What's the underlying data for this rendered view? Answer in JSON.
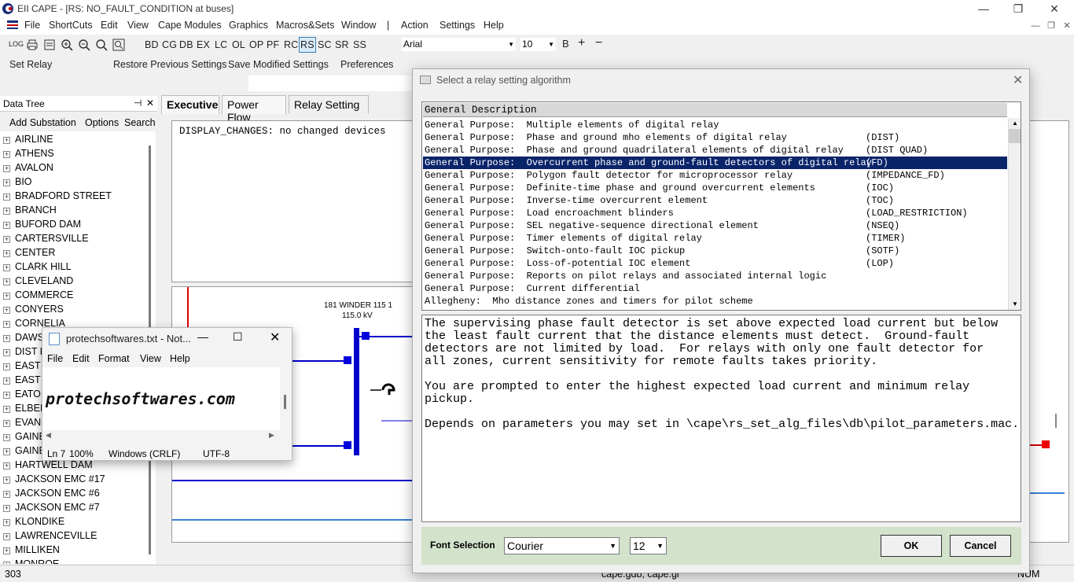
{
  "window": {
    "title": "EII CAPE - [RS: NO_FAULT_CONDITION at buses]",
    "controls": [
      "—",
      "❐",
      "✕"
    ]
  },
  "menubar": {
    "items": [
      "File",
      "ShortCuts",
      "Edit",
      "View",
      "Cape Modules",
      "Graphics",
      "Macros&Sets",
      "Window",
      "|",
      "Action",
      "Settings",
      "Help"
    ]
  },
  "toolbar": {
    "modules": [
      "BD",
      "CG",
      "DB",
      "EX",
      "LC",
      "OL",
      "OP",
      "PF",
      "RC",
      "RS",
      "SC",
      "SR",
      "SS"
    ],
    "selected_module": "RS",
    "font_name": "Arial",
    "font_size": "10",
    "bold_label": "B"
  },
  "toolbar2": {
    "items": [
      "Set Relay",
      "Restore Previous Settings",
      "Save Modified Settings",
      "Preferences"
    ]
  },
  "data_tree": {
    "title": "Data Tree",
    "pin": "⊣",
    "close": "✕",
    "tools": [
      "Add Substation",
      "Options",
      "Search"
    ],
    "items": [
      "AIRLINE",
      "ATHENS",
      "AVALON",
      "BIO",
      "BRADFORD STREET",
      "BRANCH",
      "BUFORD DAM",
      "CARTERSVILLE",
      "CENTER",
      "CLARK HILL",
      "CLEVELAND",
      "COMMERCE",
      "CONYERS",
      "CORNELIA",
      "DAWS",
      "DIST F",
      "EAST",
      "EAST",
      "EATO",
      "ELBER",
      "EVANS",
      "GAINE",
      "GAINE",
      "HARTWELL DAM",
      "JACKSON EMC #17",
      "JACKSON EMC #6",
      "JACKSON EMC #7",
      "KLONDIKE",
      "LAWRENCEVILLE",
      "MILLIKEN",
      "MONROE"
    ]
  },
  "tabs": [
    "Executive",
    "Power Flow",
    "Relay Setting"
  ],
  "active_tab": "Relay Setting",
  "display": {
    "text": "DISPLAY_CHANGES: no changed devices"
  },
  "diagram": {
    "bus_name": "181 WINDER 115 1",
    "bus_kv": "115.0 kV"
  },
  "status_bar": {
    "left": "303",
    "middle": "cape.gdb, cape.gr",
    "right": "NUM"
  },
  "notepad": {
    "title": "protechsoftwares.txt - Not...",
    "menu": [
      "File",
      "Edit",
      "Format",
      "View",
      "Help"
    ],
    "content": "protechsoftwares.com",
    "status": [
      "Ln 7",
      "100%",
      "Windows (CRLF)",
      "UTF-8"
    ]
  },
  "dialog": {
    "title": "Select a relay setting algorithm",
    "list_header": "General Description",
    "rows": [
      {
        "desc": "General Purpose:  Multiple elements of digital relay",
        "code": ""
      },
      {
        "desc": "General Purpose:  Phase and ground mho elements of digital relay",
        "code": "(DIST)"
      },
      {
        "desc": "General Purpose:  Phase and ground quadrilateral elements of digital relay",
        "code": "(DIST QUAD)"
      },
      {
        "desc": "General Purpose:  Overcurrent phase and ground-fault detectors of digital relay",
        "code": "(FD)"
      },
      {
        "desc": "General Purpose:  Polygon fault detector for microprocessor relay",
        "code": "(IMPEDANCE_FD)"
      },
      {
        "desc": "General Purpose:  Definite-time phase and ground overcurrent elements",
        "code": "(IOC)"
      },
      {
        "desc": "General Purpose:  Inverse-time overcurrent element",
        "code": "(TOC)"
      },
      {
        "desc": "General Purpose:  Load encroachment blinders",
        "code": "(LOAD_RESTRICTION)"
      },
      {
        "desc": "General Purpose:  SEL negative-sequence directional element",
        "code": "(NSEQ)"
      },
      {
        "desc": "General Purpose:  Timer elements of digital relay",
        "code": "(TIMER)"
      },
      {
        "desc": "General Purpose:  Switch-onto-fault IOC pickup",
        "code": "(SOTF)"
      },
      {
        "desc": "General Purpose:  Loss-of-potential IOC element",
        "code": "(LOP)"
      },
      {
        "desc": "General Purpose:  Reports on pilot relays and associated internal logic",
        "code": ""
      },
      {
        "desc": "General Purpose:  Current differential",
        "code": ""
      },
      {
        "desc": "Allegheny:  Mho distance zones and timers for pilot scheme",
        "code": ""
      }
    ],
    "selected_index": 3,
    "description": [
      "The supervising phase fault detector is set above expected load current but below",
      "the least fault current that the distance elements must detect.  Ground-fault",
      "detectors are not limited by load.  For relays with only one fault detector for",
      "all zones, current sensitivity for remote faults takes priority.",
      "",
      "You are prompted to enter the highest expected load current and minimum relay",
      "pickup.",
      "",
      "Depends on parameters you may set in \\cape\\rs_set_alg_files\\db\\pilot_parameters.mac."
    ],
    "font_selection_label": "Font Selection",
    "font_value": "Courier",
    "font_size_value": "12",
    "ok_label": "OK",
    "cancel_label": "Cancel"
  }
}
